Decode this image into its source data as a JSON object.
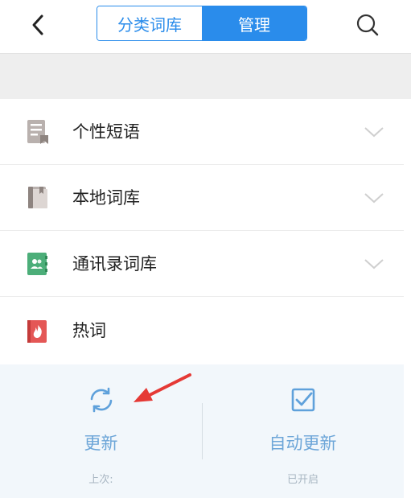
{
  "header": {
    "tabs": [
      {
        "label": "分类词库",
        "active": false
      },
      {
        "label": "管理",
        "active": true
      }
    ],
    "accent_color": "#2a8ceb"
  },
  "list": [
    {
      "label": "个性短语",
      "icon": "bookmark-doc-icon",
      "expandable": true
    },
    {
      "label": "本地词库",
      "icon": "book-icon",
      "expandable": true
    },
    {
      "label": "通讯录词库",
      "icon": "contacts-book-icon",
      "expandable": true
    },
    {
      "label": "热词",
      "icon": "flame-book-icon",
      "expandable": false
    }
  ],
  "actions": {
    "update": {
      "label": "更新",
      "sub": "上次:",
      "icon": "refresh-icon"
    },
    "auto_update": {
      "label": "自动更新",
      "sub": "已开启",
      "icon": "checkbox-checked-icon"
    }
  },
  "annotation": {
    "icon": "red-arrow-icon",
    "color": "#e53935"
  }
}
